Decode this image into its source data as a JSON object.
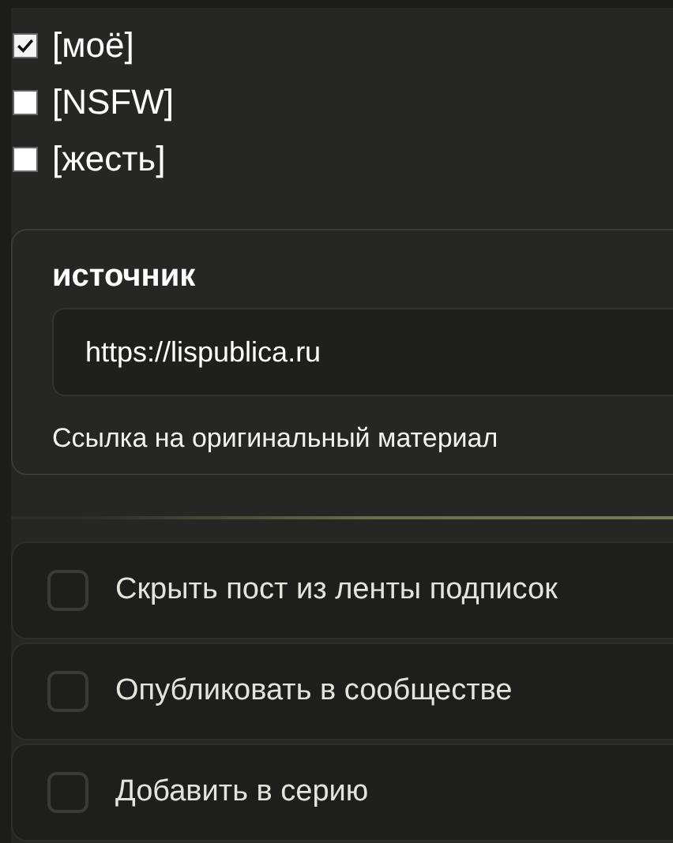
{
  "tags": [
    {
      "label": "[моё]",
      "checked": true
    },
    {
      "label": "[NSFW]",
      "checked": false
    },
    {
      "label": "[жесть]",
      "checked": false
    }
  ],
  "source": {
    "title": "источник",
    "value": "https://lispublica.ru",
    "hint": "Ссылка на оригинальный материал"
  },
  "options": [
    {
      "label": "Скрыть пост из ленты подписок",
      "checked": false
    },
    {
      "label": "Опубликовать в сообществе",
      "checked": false
    },
    {
      "label": "Добавить в серию",
      "checked": false
    }
  ]
}
